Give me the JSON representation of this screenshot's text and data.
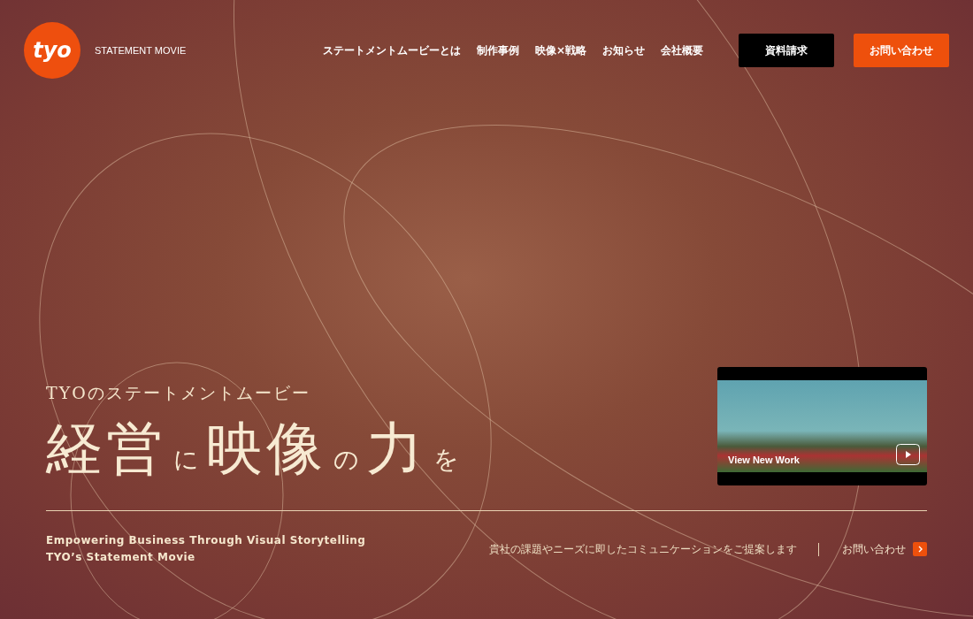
{
  "header": {
    "logo": "tyo",
    "tagline": "STATEMENT MOVIE",
    "nav": [
      "ステートメントムービーとは",
      "制作事例",
      "映像×戦略",
      "お知らせ",
      "会社概要"
    ],
    "buttons": [
      {
        "label": "資料請求",
        "kind": "dark"
      },
      {
        "label": "お問い合わせ",
        "kind": "accent"
      }
    ]
  },
  "video_card": {
    "label": "View New Work"
  },
  "hero": {
    "kicker": "TYOのステートメントムービー",
    "headline": [
      {
        "text": "経営",
        "kind": "large"
      },
      {
        "text": "に",
        "kind": "small"
      },
      {
        "text": "映像",
        "kind": "large"
      },
      {
        "text": "の",
        "kind": "small"
      },
      {
        "text": "力",
        "kind": "large"
      },
      {
        "text": "を",
        "kind": "small"
      }
    ],
    "english": [
      "Empowering Business Through Visual Storytelling",
      "TYO’s Statement Movie"
    ],
    "lead": "貴社の課題やニーズに即したコミュニケーションをご提案します",
    "contact_link": "お問い合わせ"
  }
}
